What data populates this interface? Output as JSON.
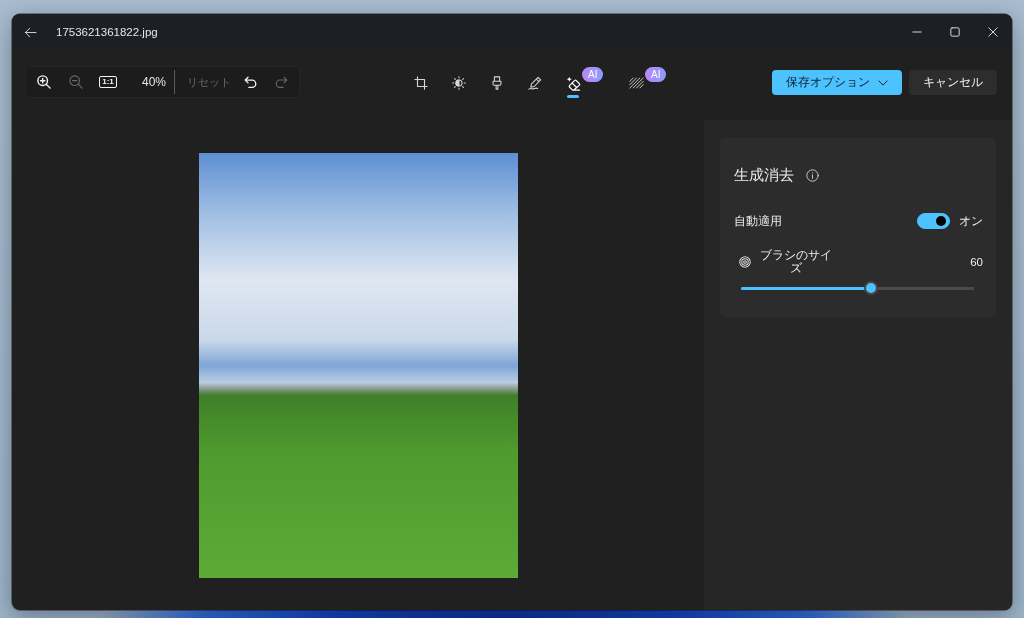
{
  "window": {
    "title": "1753621361822.jpg"
  },
  "toolbar": {
    "zoom_bar": {
      "buttons": [
        {
          "kind": "zoom_in",
          "disabled": false
        },
        {
          "kind": "zoom_out",
          "disabled": true
        },
        {
          "kind": "actual_size",
          "label": "1:1",
          "disabled": false
        }
      ],
      "zoom_value": "40%",
      "history": [
        {
          "kind": "reset",
          "label": "リセット",
          "disabled": true
        },
        {
          "kind": "undo",
          "disabled": false
        },
        {
          "kind": "redo",
          "disabled": true
        }
      ]
    },
    "tools": [
      {
        "kind": "crop",
        "selected": false
      },
      {
        "kind": "adjust",
        "selected": false
      },
      {
        "kind": "filter",
        "selected": false
      },
      {
        "kind": "markup",
        "selected": false
      },
      {
        "kind": "erase",
        "selected": true,
        "badge": "AI"
      },
      {
        "kind": "background",
        "selected": false,
        "badge": "AI"
      }
    ],
    "actions": [
      {
        "kind": "primary",
        "label": "保存オプション",
        "dropdown": true
      },
      {
        "kind": "secondary",
        "label": "キャンセル",
        "dropdown": false
      }
    ]
  },
  "panel": {
    "title": "生成消去",
    "settings": [
      {
        "kind": "toggle",
        "label": "自動適用",
        "on": true,
        "state_label": "オン"
      },
      {
        "kind": "slider",
        "label": "ブラシのサイズ",
        "reading": "60",
        "level": 0.56
      }
    ]
  }
}
